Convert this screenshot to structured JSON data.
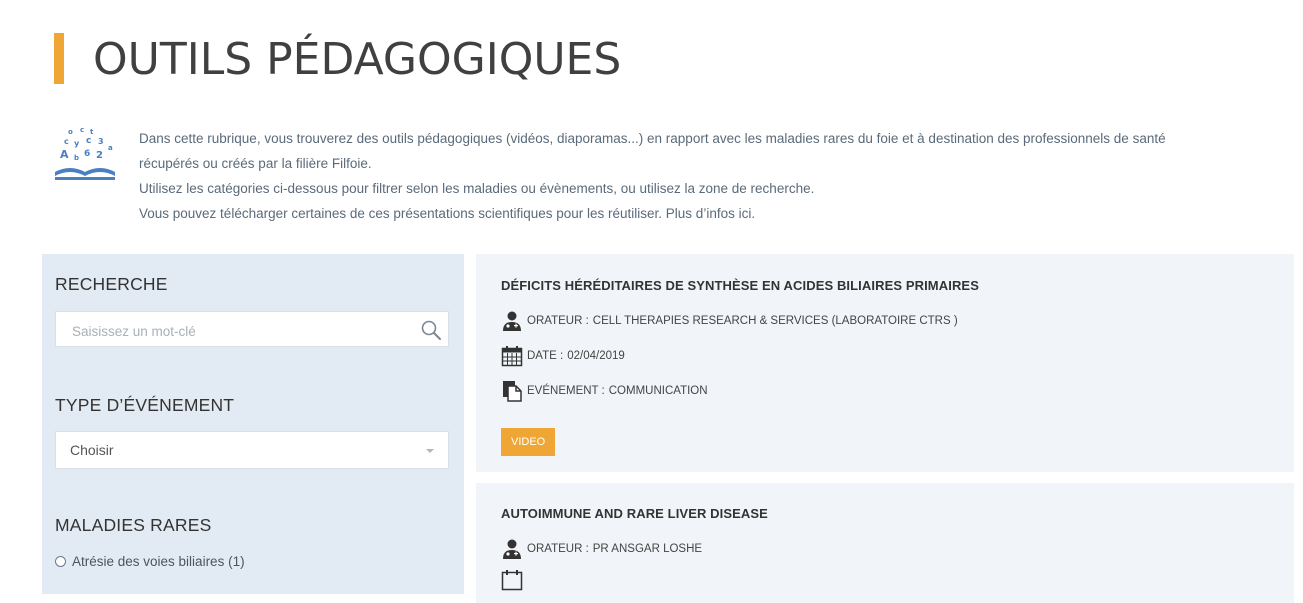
{
  "page": {
    "title": "OUTILS PÉDAGOGIQUES",
    "accent_color": "#f0a634",
    "intro": [
      "Dans cette rubrique, vous trouverez des outils pédagogiques (vidéos, diaporamas...) en rapport avec les maladies rares du foie et à destination des professionnels de santé",
      "récupérés ou créés par la filière Filfoie.",
      "Utilisez les catégories ci-dessous pour filtrer selon les maladies ou évènements, ou utilisez la zone de recherche.",
      "Vous pouvez télécharger certaines de ces présentations scientifiques pour les réutiliser. Plus d’infos ici."
    ]
  },
  "sidebar": {
    "search_heading": "RECHERCHE",
    "search_placeholder": "Saisissez un mot-clé",
    "event_type_heading": "TYPE D’ÉVÉNEMENT",
    "event_type_selected": "Choisir",
    "diseases_heading": "MALADIES RARES",
    "diseases": [
      {
        "label": "Atrésie des voies biliaires (1)"
      }
    ]
  },
  "cards": [
    {
      "title": "DÉFICITS HÉRÉDITAIRES DE SYNTHÈSE EN ACIDES BILIAIRES PRIMAIRES",
      "speaker_label": "ORATEUR :",
      "speaker": "CELL THERAPIES RESEARCH & SERVICES (LABORATOIRE CTRS )",
      "date_label": "DATE :",
      "date": "02/04/2019",
      "event_label": "EVÉNEMENT :",
      "event": "COMMUNICATION",
      "tag": "VIDEO"
    },
    {
      "title": "AUTOIMMUNE AND RARE LIVER DISEASE",
      "speaker_label": "ORATEUR :",
      "speaker": "PR ANSGAR LOSHE"
    }
  ],
  "icons": {
    "intro": "book-letters-icon",
    "search": "search-icon",
    "speaker": "doctor-icon",
    "date": "calendar-icon",
    "event": "document-icon"
  }
}
